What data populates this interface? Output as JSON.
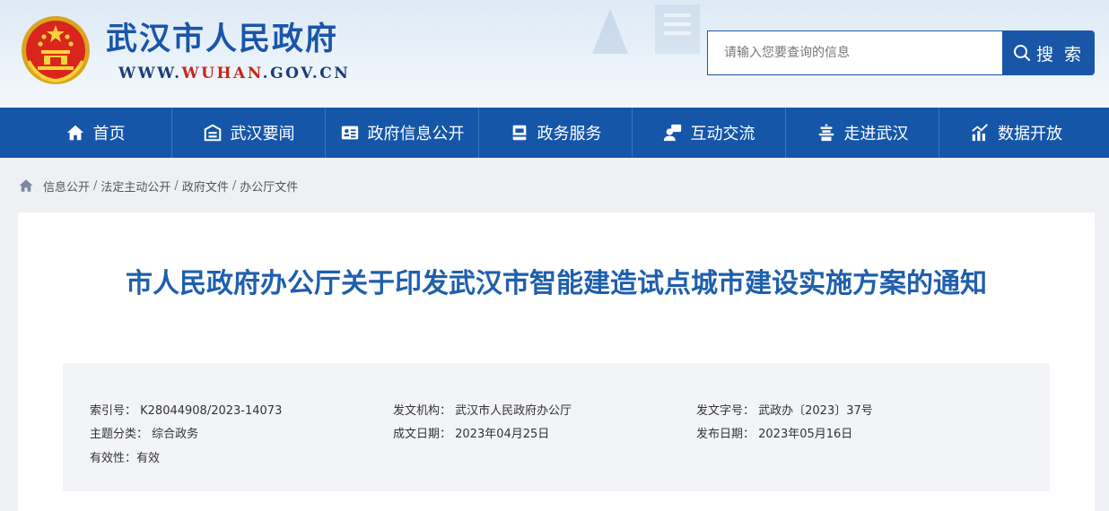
{
  "header": {
    "site_title": "武汉市人民政府",
    "domain_prefix": "WWW.",
    "domain_brand": "WUHAN",
    "domain_suffix": ".GOV.CN",
    "search_placeholder": "请输入您要查询的信息",
    "search_button_label": "搜 索"
  },
  "nav": {
    "items": [
      {
        "label": "首页",
        "icon": "home-icon"
      },
      {
        "label": "武汉要闻",
        "icon": "news-icon"
      },
      {
        "label": "政府信息公开",
        "icon": "info-card-icon"
      },
      {
        "label": "政务服务",
        "icon": "service-icon"
      },
      {
        "label": "互动交流",
        "icon": "interaction-icon"
      },
      {
        "label": "走进武汉",
        "icon": "tower-icon"
      },
      {
        "label": "数据开放",
        "icon": "data-chart-icon"
      }
    ]
  },
  "breadcrumb": {
    "items": [
      "信息公开",
      "法定主动公开",
      "政府文件",
      "办公厅文件"
    ],
    "separator": "/"
  },
  "article": {
    "title": "市人民政府办公厅关于印发武汉市智能建造试点城市建设实施方案的通知",
    "meta": {
      "index_no": "索引号： K28044908/2023-14073",
      "issuer": "发文机构： 武汉市人民政府办公厅",
      "doc_no": "发文字号： 武政办〔2023〕37号",
      "category": "主题分类： 综合政务",
      "created_date": "成文日期： 2023年04月25日",
      "published_date": "发布日期： 2023年05月16日",
      "validity": "有效性：有效"
    }
  },
  "colors": {
    "brand_blue": "#1556a8",
    "title_blue": "#1f5fad",
    "accent_red": "#c7261b"
  }
}
